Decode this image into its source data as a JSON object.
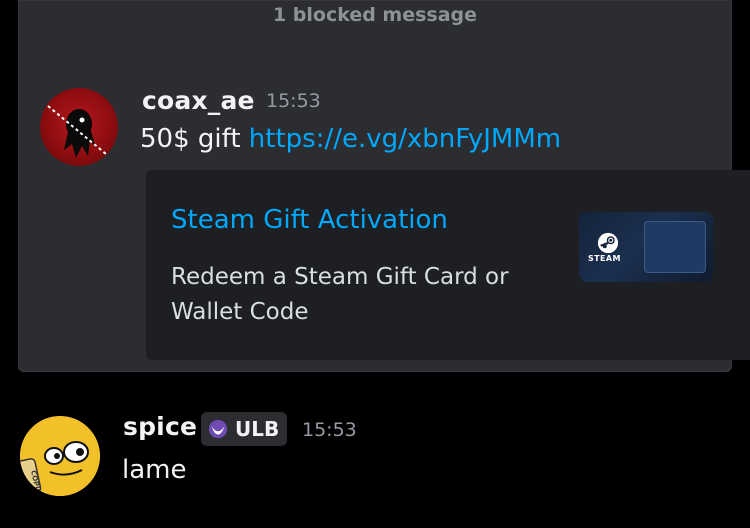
{
  "blocked": {
    "label": "1 blocked message"
  },
  "messages": [
    {
      "username": "coax_ae",
      "time": "15:53",
      "text_prefix": "50$ gift ",
      "link": "https://e.vg/xbnFyJMMm",
      "embed": {
        "title": "Steam Gift Activation",
        "description": "Redeem a Steam Gift Card or Wallet Code",
        "thumbnail_text": "STEAM",
        "thumbnail_icon": "steam-logo-icon"
      }
    },
    {
      "username": "spice",
      "tag": {
        "label": "ULB",
        "icon": "guild-tag-icon"
      },
      "time": "15:53",
      "text": "lame",
      "avatar_badge": "COPIUM"
    }
  ],
  "colors": {
    "background": "#000000",
    "panel": "#2b2d31",
    "embed": "#1e1f22",
    "link": "#00a8fc",
    "muted": "#949ba4",
    "text": "#f2f3f5"
  }
}
